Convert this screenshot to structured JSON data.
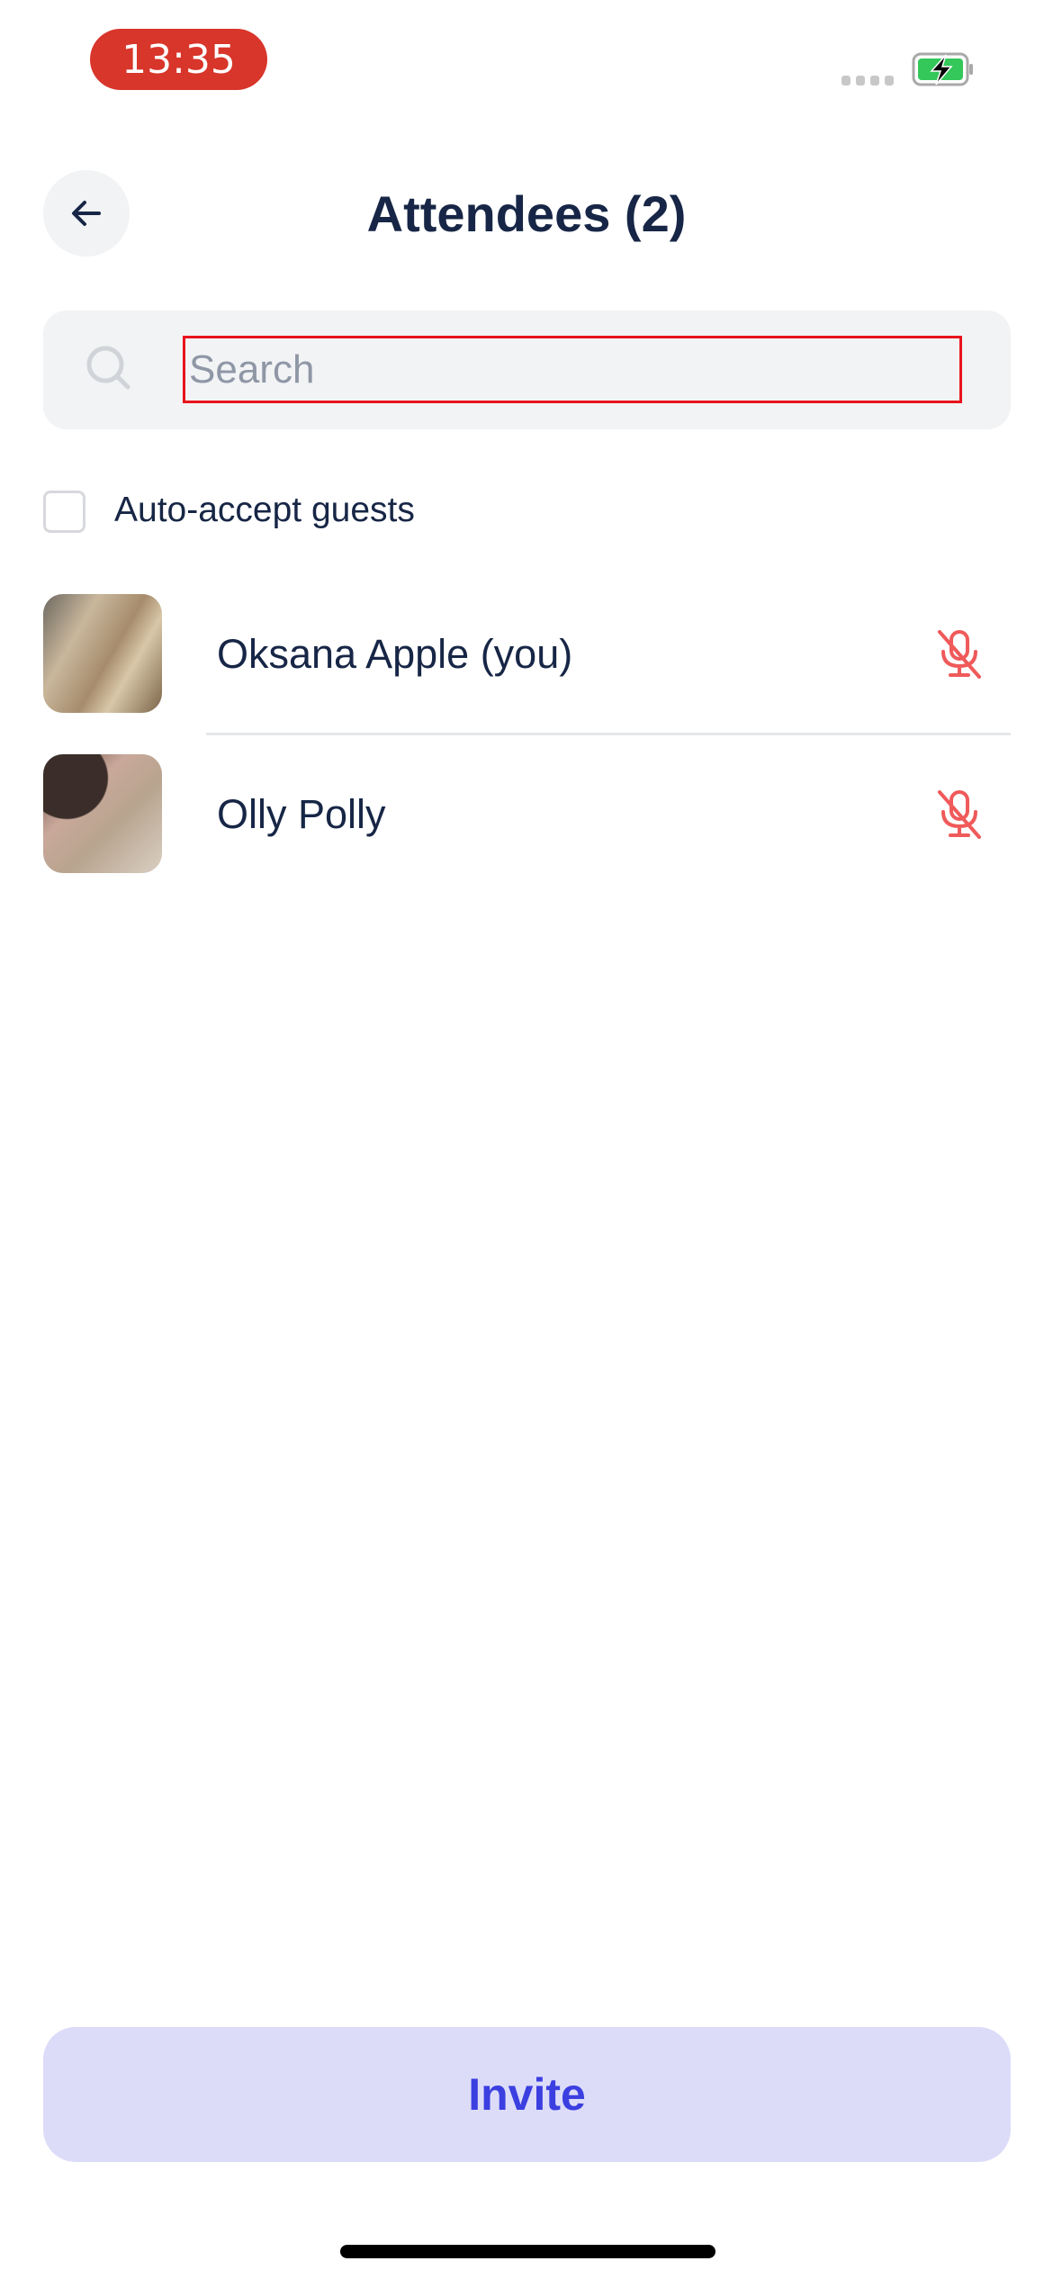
{
  "status_bar": {
    "time": "13:35",
    "time_pill_color": "#d8352b",
    "battery_state": "charging"
  },
  "header": {
    "title": "Attendees (2)",
    "back_icon": "arrow-left-icon"
  },
  "search": {
    "placeholder": "Search",
    "value": "",
    "icon": "search-icon"
  },
  "auto_accept": {
    "label": "Auto-accept guests",
    "checked": false
  },
  "attendees": [
    {
      "name": "Oksana Apple (you)",
      "mic": "mic-off-icon",
      "muted": true
    },
    {
      "name": "Olly Polly",
      "mic": "mic-off-icon",
      "muted": true
    }
  ],
  "invite": {
    "label": "Invite",
    "bg": "#dcdcf9",
    "color": "#3b3fe0"
  },
  "colors": {
    "muted_icon": "#f05a5a",
    "text": "#172646"
  }
}
